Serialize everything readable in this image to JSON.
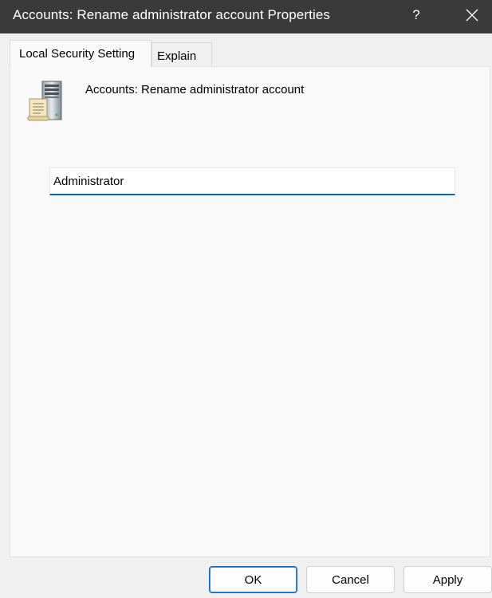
{
  "window": {
    "title": "Accounts: Rename administrator account Properties",
    "help_glyph": "?",
    "close_icon": "close-icon"
  },
  "tabs": [
    {
      "label": "Local Security Setting",
      "active": true
    },
    {
      "label": "Explain",
      "active": false
    }
  ],
  "policy": {
    "icon": "server-document-icon",
    "name": "Accounts: Rename administrator account"
  },
  "value_field": {
    "value": "Administrator",
    "accent_color": "#0067c0"
  },
  "buttons": {
    "ok": "OK",
    "cancel": "Cancel",
    "apply": "Apply"
  },
  "colors": {
    "titlebar_bg": "#3a3a3a",
    "panel_bg": "#f9f9f9",
    "accent": "#0067c0"
  }
}
